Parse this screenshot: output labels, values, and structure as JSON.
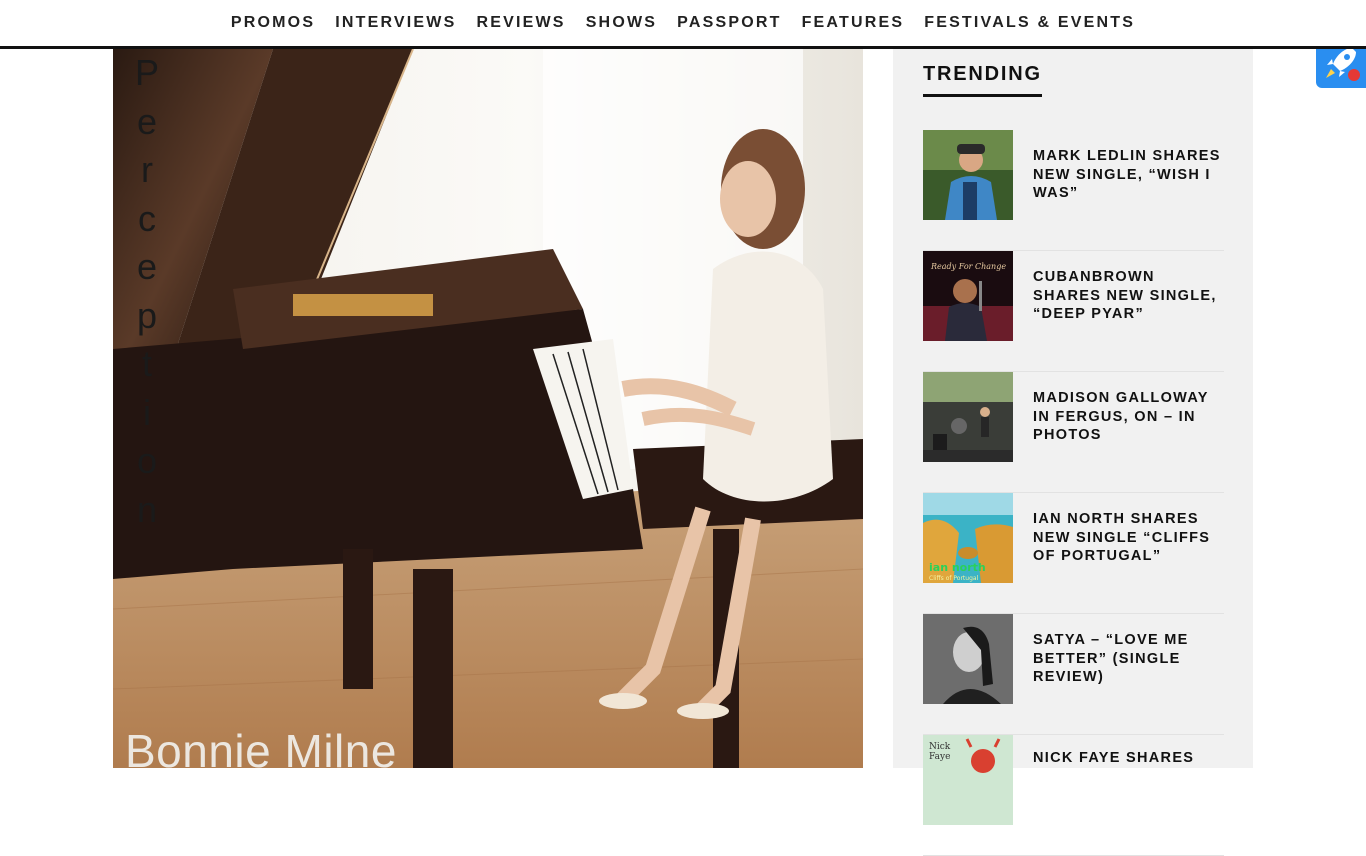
{
  "nav": {
    "items": [
      "PROMOS",
      "INTERVIEWS",
      "REVIEWS",
      "SHOWS",
      "PASSPORT",
      "FEATURES",
      "FESTIVALS & EVENTS"
    ]
  },
  "feature": {
    "cover_title_letters": [
      "P",
      "e",
      "r",
      "c",
      "e",
      "p",
      "t",
      "i",
      "o",
      "n"
    ],
    "cover_artist": "Bonnie Milne"
  },
  "sidebar": {
    "heading": "TRENDING",
    "items": [
      {
        "title": "MARK LEDLIN SHARES NEW SINGLE, “WISH I WAS”",
        "thumb": "man-in-blue-jacket-photo"
      },
      {
        "title": "CUBANBROWN SHARES NEW SINGLE, “DEEP PYAR”",
        "thumb": "ready-for-change-cover"
      },
      {
        "title": "MADISON GALLOWAY IN FERGUS, ON – IN PHOTOS",
        "thumb": "outdoor-stage-band-photo"
      },
      {
        "title": "IAN NORTH SHARES NEW SINGLE “CLIFFS OF PORTUGAL”",
        "thumb": "coastal-cliffs-cover",
        "thumb_text": [
          "ian north",
          "Cliffs of Portugal"
        ]
      },
      {
        "title": "SATYA – “LOVE ME BETTER” (SINGLE REVIEW)",
        "thumb": "bw-portrait-photo"
      },
      {
        "title": "NICK FAYE SHARES",
        "thumb": "nick-faye-cover",
        "thumb_text": [
          "Nick",
          "Faye"
        ]
      }
    ]
  },
  "colors": {
    "accent": "#111111",
    "sidebar_bg": "#f1f1f1",
    "widget_blue": "#2a8ef0"
  }
}
